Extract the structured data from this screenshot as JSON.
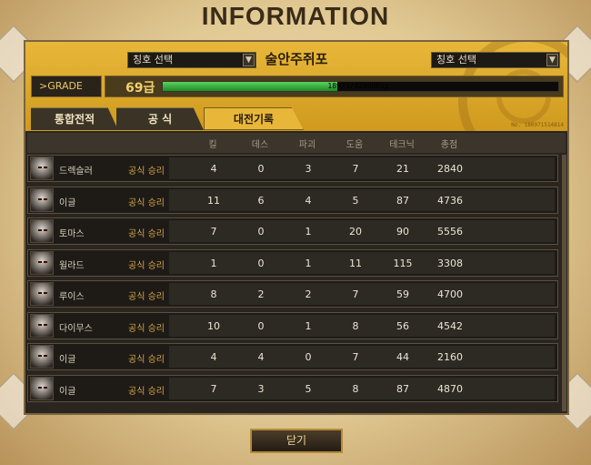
{
  "window": {
    "title": "INFORMATION"
  },
  "header": {
    "title_select_left": "칭호 선택",
    "title_select_right": "칭호 선택",
    "player_name": "술안주쥐포",
    "grade_label": ">GRADE",
    "grade_level": "69급",
    "exp_text": "18923/42800Exp.",
    "exp_current": 18923,
    "exp_max": 42800,
    "build_tag": "No. 180971514814"
  },
  "tabs": [
    {
      "label": "통합전적",
      "active": false
    },
    {
      "label": "공 식",
      "active": false
    },
    {
      "label": "대전기록",
      "active": true
    }
  ],
  "columns": [
    "킬",
    "데스",
    "파괴",
    "도움",
    "테크닉",
    "총점"
  ],
  "rows": [
    {
      "name": "드렉슬러",
      "result": "공식 승리",
      "kill": "4",
      "death": "0",
      "destroy": "3",
      "assist": "7",
      "technique": "21",
      "total": "2840"
    },
    {
      "name": "이글",
      "result": "공식 승리",
      "kill": "11",
      "death": "6",
      "destroy": "4",
      "assist": "5",
      "technique": "87",
      "total": "4736"
    },
    {
      "name": "토마스",
      "result": "공식 승리",
      "kill": "7",
      "death": "0",
      "destroy": "1",
      "assist": "20",
      "technique": "90",
      "total": "5556"
    },
    {
      "name": "윌라드",
      "result": "공식 승리",
      "kill": "1",
      "death": "0",
      "destroy": "1",
      "assist": "11",
      "technique": "115",
      "total": "3308"
    },
    {
      "name": "루이스",
      "result": "공식 승리",
      "kill": "8",
      "death": "2",
      "destroy": "2",
      "assist": "7",
      "technique": "59",
      "total": "4700"
    },
    {
      "name": "다이무스",
      "result": "공식 승리",
      "kill": "10",
      "death": "0",
      "destroy": "1",
      "assist": "8",
      "technique": "56",
      "total": "4542"
    },
    {
      "name": "이글",
      "result": "공식 승리",
      "kill": "4",
      "death": "4",
      "destroy": "0",
      "assist": "7",
      "technique": "44",
      "total": "2160"
    },
    {
      "name": "이글",
      "result": "공식 승리",
      "kill": "7",
      "death": "3",
      "destroy": "5",
      "assist": "8",
      "technique": "87",
      "total": "4870"
    }
  ],
  "footer": {
    "close_label": "닫기"
  },
  "colors": {
    "accent": "#e8b73a",
    "panel": "#2a251f",
    "exp_bar": "#2fae3b"
  }
}
